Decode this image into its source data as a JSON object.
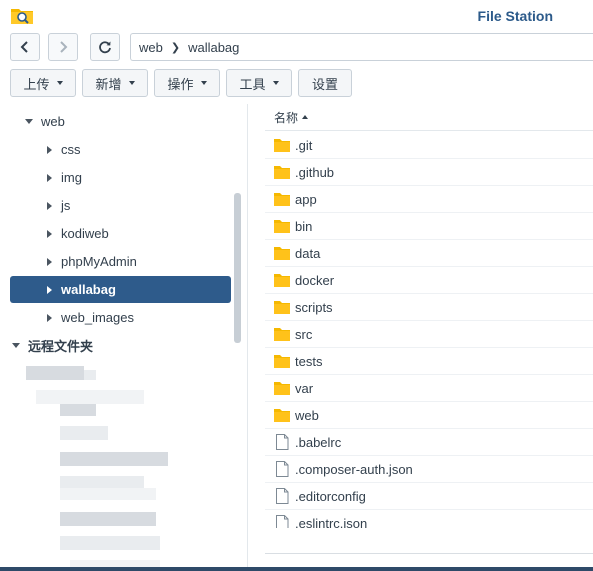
{
  "app": {
    "title": "File Station",
    "icon": "folder-search-icon"
  },
  "nav": {
    "back_icon": "chevron-left-icon",
    "forward_icon": "chevron-right-icon",
    "refresh_icon": "refresh-icon"
  },
  "path": {
    "segments": [
      "web",
      "wallabag"
    ]
  },
  "toolbar": {
    "upload": "上传",
    "create": "新增",
    "action": "操作",
    "tools": "工具",
    "settings": "设置"
  },
  "tree": {
    "root": "web",
    "children": [
      "css",
      "img",
      "js",
      "kodiweb",
      "phpMyAdmin",
      "wallabag",
      "web_images"
    ],
    "selected": "wallabag",
    "remote_section": "远程文件夹"
  },
  "filelist": {
    "column_name": "名称",
    "items": [
      {
        "name": ".git",
        "type": "folder"
      },
      {
        "name": ".github",
        "type": "folder"
      },
      {
        "name": "app",
        "type": "folder"
      },
      {
        "name": "bin",
        "type": "folder"
      },
      {
        "name": "data",
        "type": "folder"
      },
      {
        "name": "docker",
        "type": "folder"
      },
      {
        "name": "scripts",
        "type": "folder"
      },
      {
        "name": "src",
        "type": "folder"
      },
      {
        "name": "tests",
        "type": "folder"
      },
      {
        "name": "var",
        "type": "folder"
      },
      {
        "name": "web",
        "type": "folder"
      },
      {
        "name": ".babelrc",
        "type": "file"
      },
      {
        "name": ".composer-auth.json",
        "type": "file"
      },
      {
        "name": ".editorconfig",
        "type": "file"
      },
      {
        "name": ".eslintrc.json",
        "type": "file"
      }
    ]
  },
  "colors": {
    "accent": "#2e5b8b",
    "title": "#2c5a8a",
    "folder": "#f5b800",
    "text": "#33404d"
  }
}
